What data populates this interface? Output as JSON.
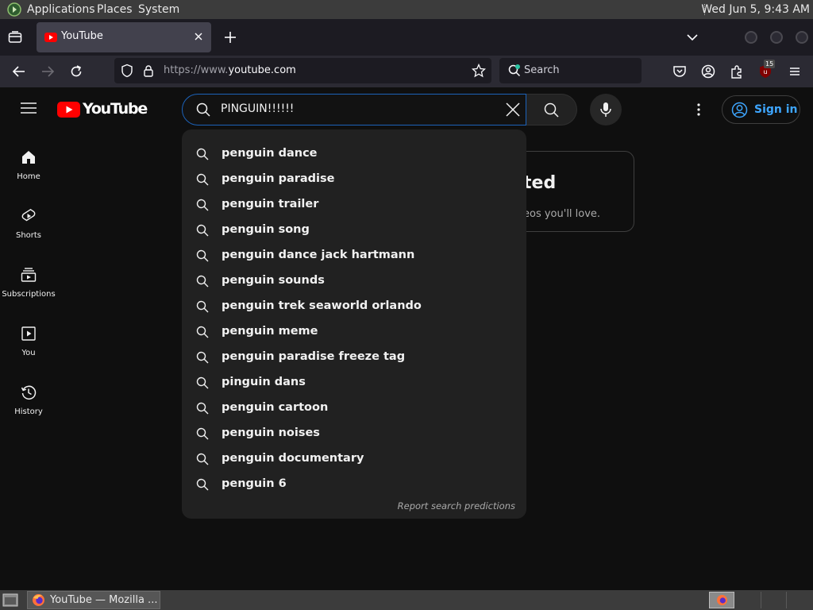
{
  "panel": {
    "menus": [
      "Applications",
      "Places",
      "System"
    ],
    "clock": "Wed Jun  5,  9:43 AM"
  },
  "browser": {
    "tab_title": "YouTube",
    "url_prefix": "https://www.",
    "url_domain": "youtube.com",
    "search_placeholder": "Search",
    "extension_badge": "15"
  },
  "youtube": {
    "logo_text": "YouTube",
    "search_query": "PINGUIN!!!!!!",
    "sign_in_label": "Sign in",
    "guide": [
      {
        "label": "Home",
        "icon": "home-icon"
      },
      {
        "label": "Shorts",
        "icon": "shorts-icon"
      },
      {
        "label": "Subscriptions",
        "icon": "subscriptions-icon"
      },
      {
        "label": "You",
        "icon": "you-icon"
      },
      {
        "label": "History",
        "icon": "history-icon"
      }
    ],
    "background_card": {
      "title_fragment": "ted",
      "subtitle_fragment": "eos you'll love."
    },
    "suggestions": [
      "penguin dance",
      "penguin paradise",
      "penguin trailer",
      "penguin song",
      "penguin dance jack hartmann",
      "penguin sounds",
      "penguin trek seaworld orlando",
      "penguin meme",
      "penguin paradise freeze tag",
      "pinguin dans",
      "penguin cartoon",
      "penguin noises",
      "penguin documentary",
      "penguin 6"
    ],
    "report_label": "Report search predictions"
  },
  "taskbar": {
    "window_label": "YouTube — Mozilla ..."
  },
  "colors": {
    "youtube_red": "#ff0000",
    "link_blue": "#3ea6ff",
    "focus_blue": "#1c62b9",
    "page_bg": "#0f0f0f",
    "dropdown_bg": "#212121"
  }
}
